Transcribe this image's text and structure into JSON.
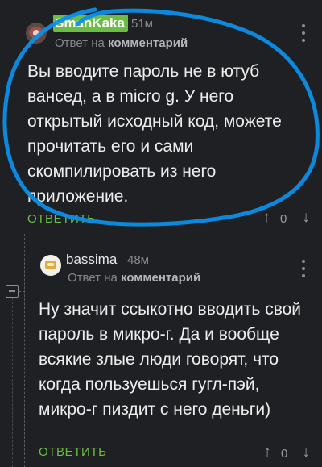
{
  "comments": [
    {
      "username": "SmanKaka",
      "age": "51м",
      "reply_prefix": "Ответ на",
      "reply_target": "комментарий",
      "text": "Вы вводите пароль не в ютуб вансед, а в micro g. У него открытый исходный код, можете прочитать его и сами скомпилировать из него приложение.",
      "reply_label": "ОТВЕТИТЬ",
      "score": "0",
      "more_icon": "vertical-dots-icon",
      "upvote_icon": "↑",
      "downvote_icon": "↓"
    },
    {
      "username": "bassima",
      "age": "48м",
      "reply_prefix": "Ответ на",
      "reply_target": "комментарий",
      "text": "Ну значит ссыкотно вводить свой пароль в микро-г. Да и вообще всякие злые люди говорят, что когда пользуешься гугл-пэй, микро-г пиздит с него деньги)",
      "reply_label": "ОТВЕТИТЬ",
      "score": "0",
      "more_icon": "vertical-dots-icon",
      "upvote_icon": "↑",
      "downvote_icon": "↓"
    }
  ],
  "colors": {
    "background": "#1f2023",
    "accent_green": "#6bbd43",
    "annotation_blue": "#0b8fe8"
  }
}
